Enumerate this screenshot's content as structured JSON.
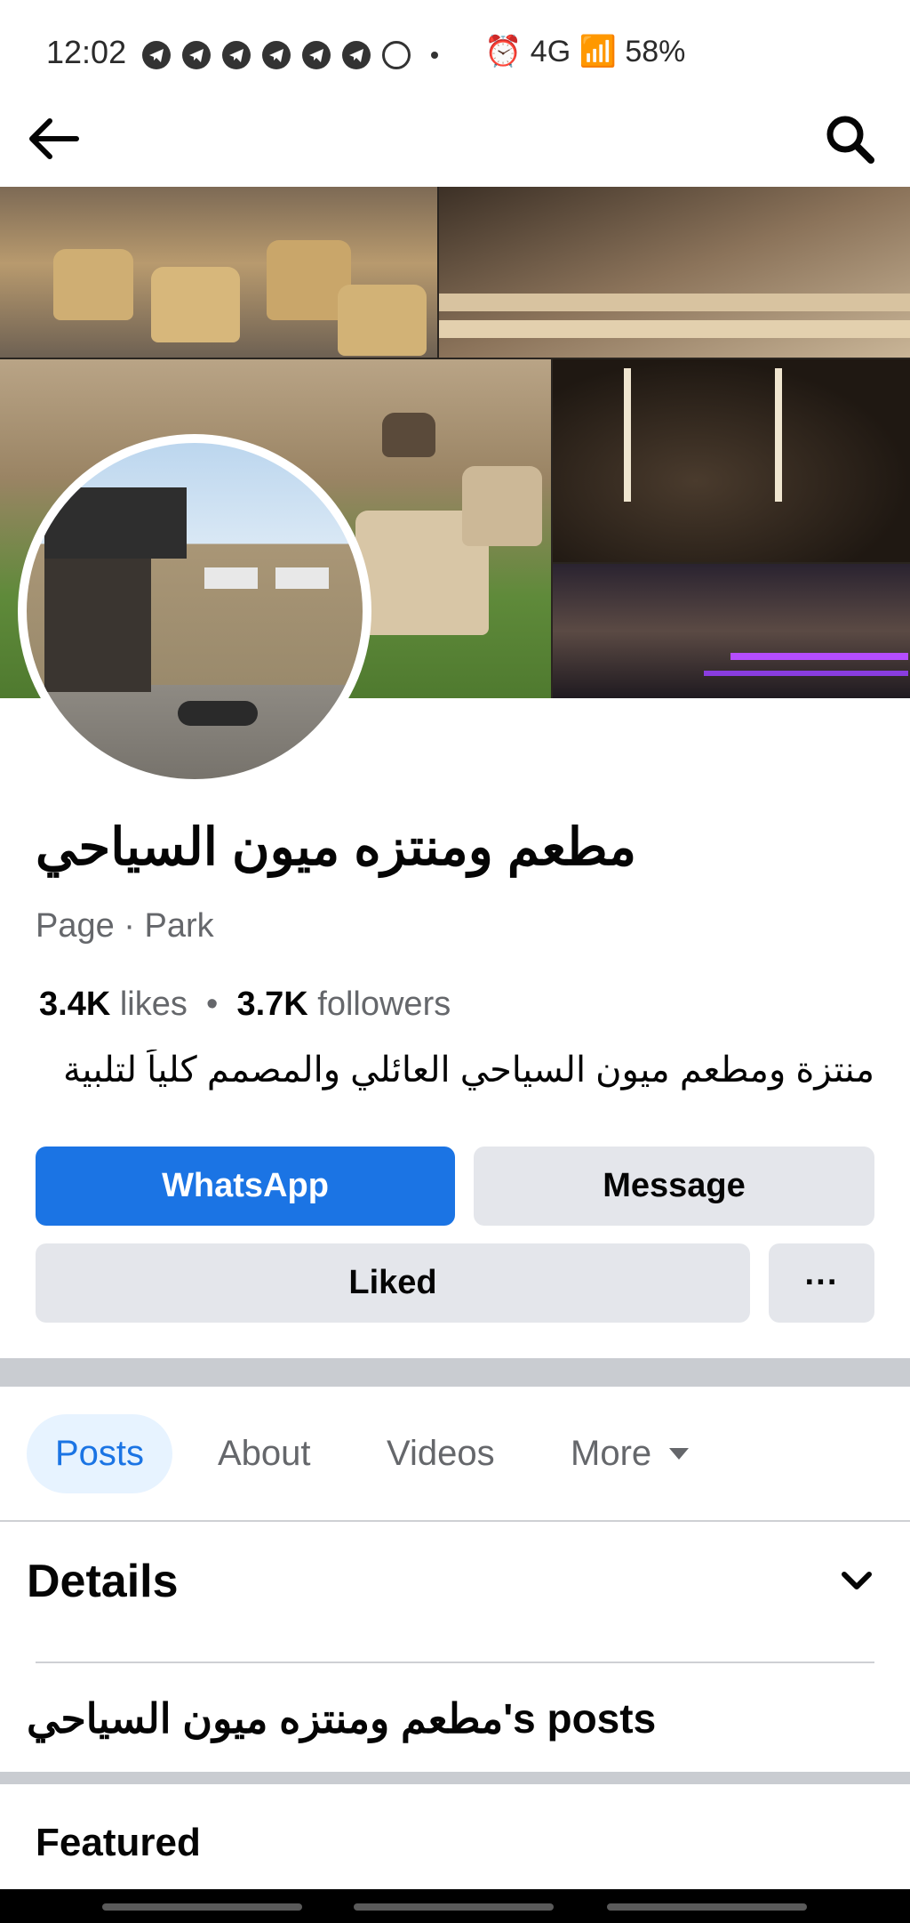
{
  "status_bar": {
    "time": "12:02",
    "right_text": "⏰ 4G 📶 58%",
    "battery": "58%"
  },
  "nav": {
    "back_icon": "arrow-left-icon",
    "search_icon": "search-icon"
  },
  "page": {
    "name": "مطعم ومنتزه ميون السياحي",
    "category": "Page · Park",
    "likes_count": "3.4K",
    "likes_label": "likes",
    "followers_count": "3.7K",
    "followers_label": "followers",
    "stats_separator": "•",
    "description": "منتزة ومطعم ميون السياحي العائلي والمصمم كلياً لتلبية"
  },
  "buttons": {
    "whatsapp": "WhatsApp",
    "message": "Message",
    "liked": "Liked",
    "more": "···"
  },
  "tabs": [
    {
      "label": "Posts",
      "active": true
    },
    {
      "label": "About"
    },
    {
      "label": "Videos"
    },
    {
      "label": "More"
    }
  ],
  "details": {
    "title": "Details",
    "posts_heading": "مطعم ومنتزه ميون السياحي's posts"
  },
  "featured": {
    "title": "Featured"
  },
  "colors": {
    "primary": "#1b74e4",
    "button_gray": "#e4e6eb",
    "separator": "#c9ccd1",
    "secondary_text": "#65676b"
  }
}
